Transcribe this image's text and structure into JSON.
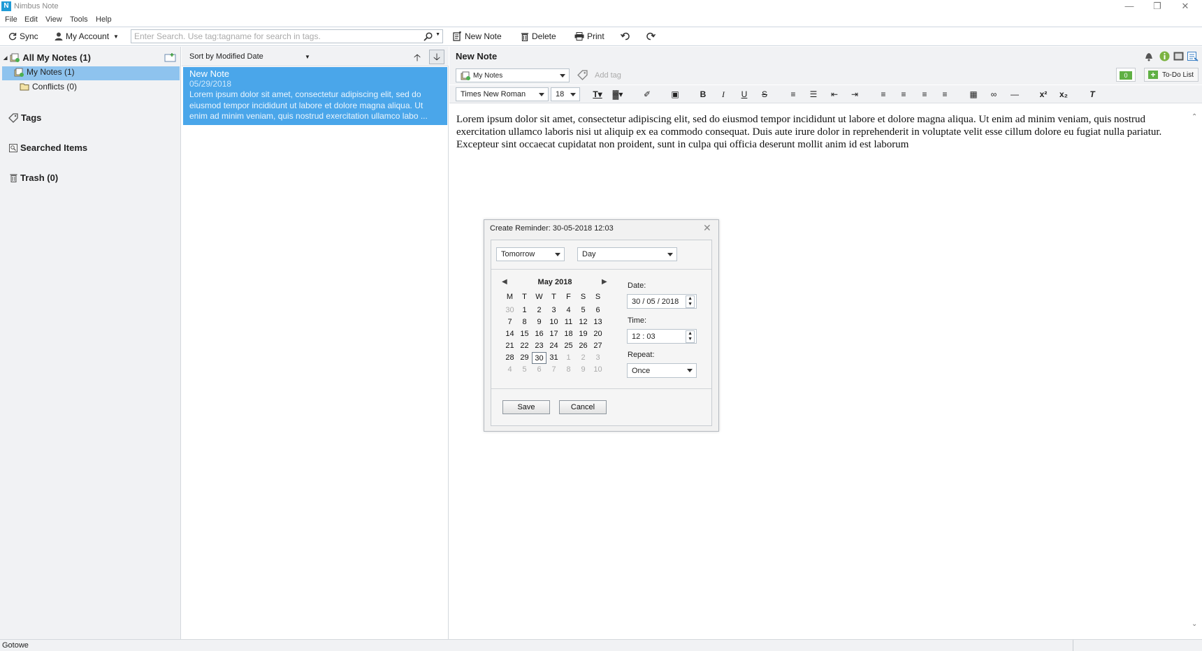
{
  "window": {
    "title": "Nimbus Note",
    "logo_letter": "N"
  },
  "menu": [
    "File",
    "Edit",
    "View",
    "Tools",
    "Help"
  ],
  "toolbar": {
    "sync": "Sync",
    "account": "My Account",
    "search_placeholder": "Enter Search. Use tag:tagname for search in tags.",
    "new_note": "New Note",
    "delete": "Delete",
    "print": "Print"
  },
  "sidebar": {
    "all_notes": "All My Notes (1)",
    "my_notes": "My Notes (1)",
    "conflicts": "Conflicts (0)",
    "tags": "Tags",
    "searched": "Searched Items",
    "trash": "Trash (0)"
  },
  "notelist": {
    "sort_label": "Sort by Modified Date",
    "note": {
      "title": "New Note",
      "date": "05/29/2018",
      "preview": "Lorem ipsum dolor sit amet, consectetur adipiscing elit, sed do eiusmod tempor incididunt ut labore et dolore magna aliqua. Ut enim ad minim veniam, quis nostrud exercitation ullamco labo ..."
    }
  },
  "editor": {
    "title": "New Note",
    "folder": "My Notes",
    "tag_placeholder": "Add tag",
    "todo_count": "0",
    "todo_label": "To-Do List",
    "font": "Times New Roman",
    "size": "18",
    "body": "Lorem ipsum dolor sit amet, consectetur adipiscing elit, sed do eiusmod tempor incididunt ut labore et dolore magna aliqua. Ut enim ad minim veniam, quis nostrud exercitation ullamco laboris nisi ut aliquip ex ea commodo consequat. Duis aute irure dolor in reprehenderit in voluptate velit esse cillum dolore eu fugiat nulla pariatur. Excepteur sint occaecat cupidatat non proident, sunt in culpa qui officia deserunt mollit anim id est laborum"
  },
  "reminder": {
    "title": "Create Reminder:  30-05-2018  12:03",
    "preset": "Tomorrow",
    "unit": "Day",
    "month": "May 2018",
    "weekdays": [
      "M",
      "T",
      "W",
      "T",
      "F",
      "S",
      "S"
    ],
    "weeks": [
      [
        "30",
        "1",
        "2",
        "3",
        "4",
        "5",
        "6"
      ],
      [
        "7",
        "8",
        "9",
        "10",
        "11",
        "12",
        "13"
      ],
      [
        "14",
        "15",
        "16",
        "17",
        "18",
        "19",
        "20"
      ],
      [
        "21",
        "22",
        "23",
        "24",
        "25",
        "26",
        "27"
      ],
      [
        "28",
        "29",
        "30",
        "31",
        "1",
        "2",
        "3"
      ],
      [
        "4",
        "5",
        "6",
        "7",
        "8",
        "9",
        "10"
      ]
    ],
    "date_label": "Date:",
    "date_value": "30 / 05 / 2018",
    "time_label": "Time:",
    "time_value": "12 : 03",
    "repeat_label": "Repeat:",
    "repeat_value": "Once",
    "save": "Save",
    "cancel": "Cancel"
  },
  "status": {
    "text": "Gotowe"
  }
}
